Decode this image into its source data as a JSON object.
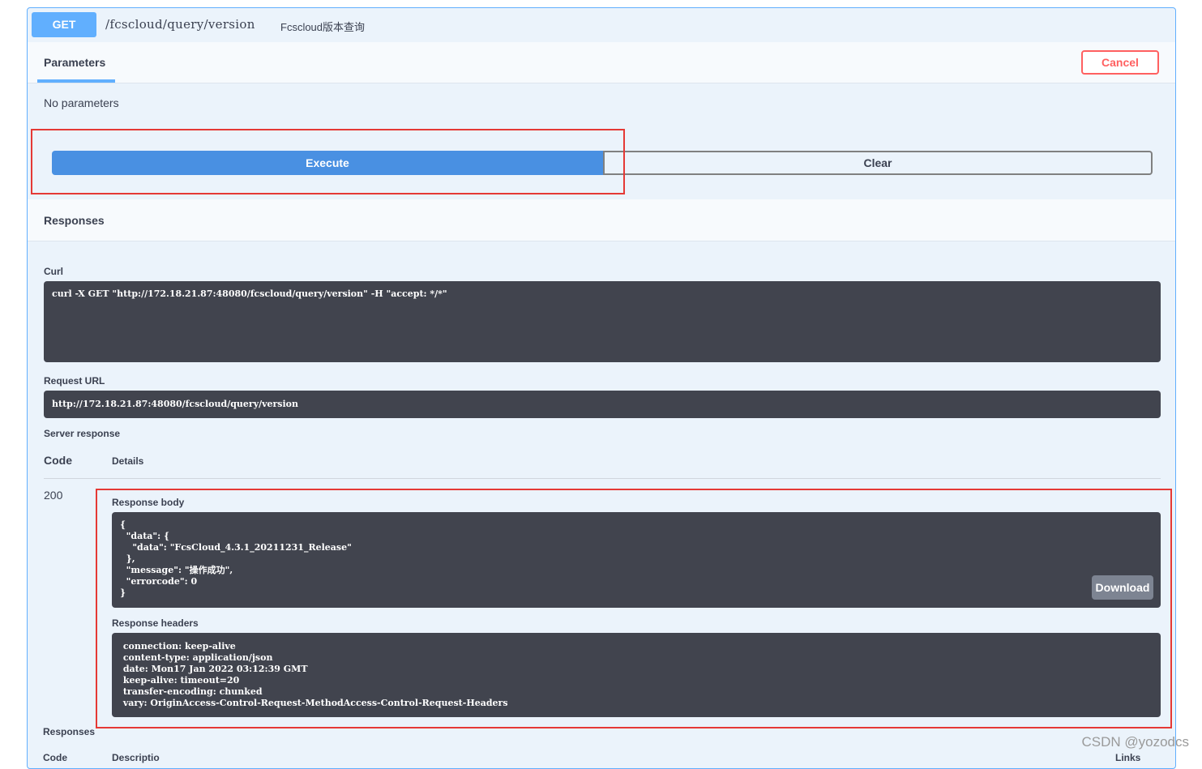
{
  "operation": {
    "method": "GET",
    "path": "/fcscloud/query/version",
    "description": "Fcscloud版本查询"
  },
  "parameters": {
    "tab_label": "Parameters",
    "cancel_label": "Cancel",
    "empty_text": "No parameters"
  },
  "actions": {
    "execute_label": "Execute",
    "clear_label": "Clear"
  },
  "responses": {
    "title": "Responses",
    "curl_label": "Curl",
    "curl_command": "curl -X GET \"http://172.18.21.87:48080/fcscloud/query/version\" -H \"accept: */*\"",
    "request_url_label": "Request URL",
    "request_url": "http://172.18.21.87:48080/fcscloud/query/version",
    "server_response_label": "Server response",
    "code_header": "Code",
    "details_header": "Details",
    "status_code": "200",
    "body_label": "Response body",
    "body": "{\n  \"data\": {\n    \"data\": \"FcsCloud_4.3.1_20211231_Release\"\n  },\n  \"message\": \"操作成功\",\n  \"errorcode\": 0\n}",
    "download_label": "Download",
    "headers_label": "Response headers",
    "headers": " connection: keep-alive\n content-type: application/json\n date: Mon17 Jan 2022 03:12:39 GMT\n keep-alive: timeout=20\n transfer-encoding: chunked\n vary: OriginAccess-Control-Request-MethodAccess-Control-Request-Headers"
  },
  "footer": {
    "responses_label": "Responses",
    "code_partial": "Code",
    "description_partial": "Descriptio",
    "links_partial": "Links"
  },
  "watermark": "CSDN @yozodcs",
  "colors": {
    "get_blue": "#61affe",
    "execute_blue": "#4990e2",
    "cancel_red": "#ff6060",
    "highlight_red": "#e53935",
    "code_bg": "#41444e"
  }
}
